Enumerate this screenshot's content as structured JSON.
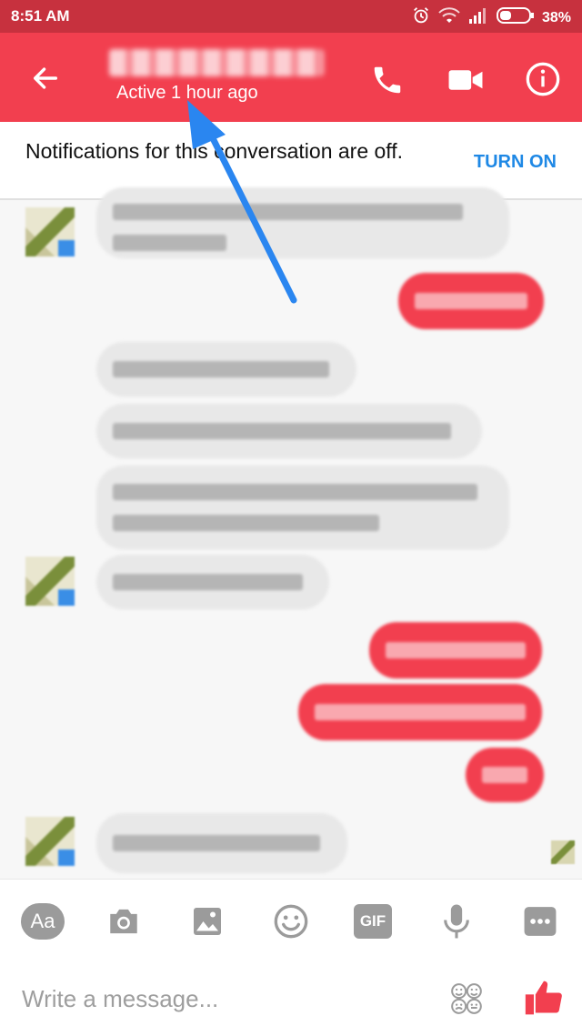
{
  "status_bar": {
    "time": "8:51 AM",
    "battery_percent": "38%"
  },
  "header": {
    "status": "Active 1 hour ago",
    "icons": [
      "back-arrow-icon",
      "phone-icon",
      "video-camera-icon",
      "info-icon"
    ]
  },
  "notice": {
    "text": "Notifications for this conversation are off.",
    "action_label": "TURN ON"
  },
  "composer": {
    "placeholder": "Write a message...",
    "aa_label": "Aa",
    "gif_label": "GIF",
    "tools": [
      "text-style-icon",
      "camera-icon",
      "image-icon",
      "emoji-icon",
      "gif-icon",
      "microphone-icon",
      "more-icon"
    ]
  },
  "colors": {
    "status_bar": "#c7313e",
    "header": "#f23f4f",
    "accent_blue": "#1e88e5",
    "outgoing_bubble": "#f23f4f",
    "incoming_bubble": "#e8e8e8"
  }
}
